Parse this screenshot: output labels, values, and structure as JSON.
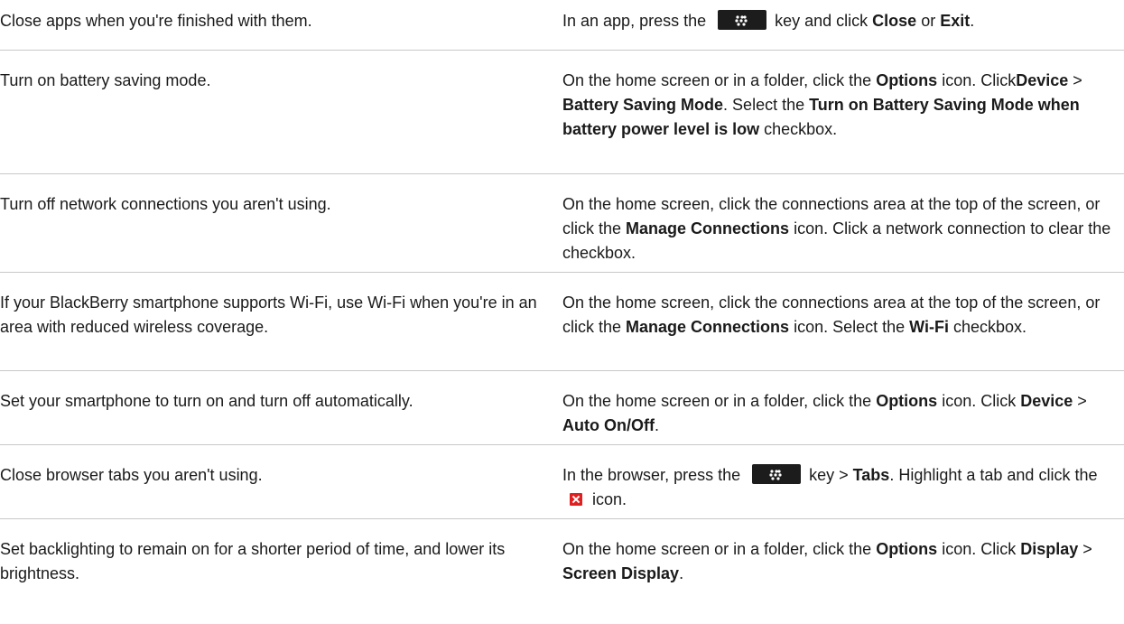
{
  "rows": [
    {
      "tip": "Close apps when you're finished with them.",
      "how": [
        {
          "t": "text",
          "v": "In an app, press the "
        },
        {
          "t": "icon",
          "icon": "menu-key-icon"
        },
        {
          "t": "text",
          "v": " key and click "
        },
        {
          "t": "bold",
          "v": "Close"
        },
        {
          "t": "text",
          "v": " or "
        },
        {
          "t": "bold",
          "v": "Exit"
        },
        {
          "t": "text",
          "v": "."
        }
      ]
    },
    {
      "tip": "Turn on battery saving mode.",
      "how": [
        {
          "t": "text",
          "v": "On the home screen or in a folder, click the "
        },
        {
          "t": "bold",
          "v": "Options"
        },
        {
          "t": "text",
          "v": " icon. Click"
        },
        {
          "t": "bold",
          "v": "Device"
        },
        {
          "t": "text",
          "v": " > "
        },
        {
          "t": "bold",
          "v": "Battery Saving Mode"
        },
        {
          "t": "text",
          "v": ". Select the "
        },
        {
          "t": "bold",
          "v": "Turn on Battery Saving Mode when battery power level is low"
        },
        {
          "t": "text",
          "v": " checkbox."
        }
      ]
    },
    {
      "tip": "Turn off network connections you aren't using.",
      "how": [
        {
          "t": "text",
          "v": "On the home screen, click the connections area at the top of the screen, or click the "
        },
        {
          "t": "bold",
          "v": "Manage Connections"
        },
        {
          "t": "text",
          "v": " icon. Click a network connection to clear the checkbox."
        }
      ]
    },
    {
      "tip": "If your BlackBerry smartphone supports Wi-Fi, use Wi-Fi when you're in an area with reduced wireless coverage.",
      "how": [
        {
          "t": "text",
          "v": "On the home screen, click the connections area at the top of the screen, or click the "
        },
        {
          "t": "bold",
          "v": "Manage Connections"
        },
        {
          "t": "text",
          "v": " icon. Select the "
        },
        {
          "t": "bold",
          "v": "Wi-Fi"
        },
        {
          "t": "text",
          "v": " checkbox."
        }
      ]
    },
    {
      "tip": "Set your smartphone to turn on and turn off automatically.",
      "how": [
        {
          "t": "text",
          "v": "On the home screen or in a folder, click the "
        },
        {
          "t": "bold",
          "v": "Options"
        },
        {
          "t": "text",
          "v": " icon. Click "
        },
        {
          "t": "bold",
          "v": "Device"
        },
        {
          "t": "text",
          "v": " > "
        },
        {
          "t": "bold",
          "v": "Auto On/Off"
        },
        {
          "t": "text",
          "v": "."
        }
      ]
    },
    {
      "tip": "Close browser tabs you aren't using.",
      "how": [
        {
          "t": "text",
          "v": "In the browser, press the "
        },
        {
          "t": "icon",
          "icon": "menu-key-icon"
        },
        {
          "t": "text",
          "v": " key > "
        },
        {
          "t": "bold",
          "v": "Tabs"
        },
        {
          "t": "text",
          "v": ". Highlight a tab and click the "
        },
        {
          "t": "icon",
          "icon": "close-tab-icon"
        },
        {
          "t": "text",
          "v": " icon."
        }
      ]
    },
    {
      "tip": "Set backlighting to remain on for a shorter period of time, and lower its brightness.",
      "how": [
        {
          "t": "text",
          "v": "On the home screen or in a folder, click the "
        },
        {
          "t": "bold",
          "v": "Options"
        },
        {
          "t": "text",
          "v": " icon. Click "
        },
        {
          "t": "bold",
          "v": "Display"
        },
        {
          "t": "text",
          "v": " > "
        },
        {
          "t": "bold",
          "v": "Screen Display"
        },
        {
          "t": "text",
          "v": "."
        }
      ]
    }
  ]
}
